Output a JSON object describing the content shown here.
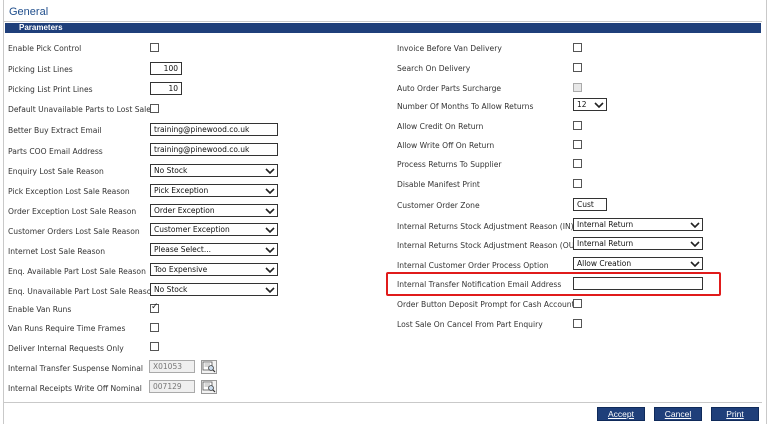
{
  "header": {
    "title": "General",
    "section": "Parameters"
  },
  "left": {
    "enable_pick_control": "Enable Pick Control",
    "picking_list_lines": "Picking List Lines",
    "picking_list_lines_value": "100",
    "picking_list_print_lines": "Picking List Print Lines",
    "picking_list_print_lines_value": "10",
    "default_unavailable": "Default Unavailable Parts to Lost Sale",
    "better_buy_email": "Better Buy Extract Email",
    "better_buy_email_value": "training@pinewood.co.uk",
    "parts_coo_email": "Parts COO Email Address",
    "parts_coo_email_value": "training@pinewood.co.uk",
    "enquiry_lost_sale": "Enquiry Lost Sale Reason",
    "enquiry_lost_sale_value": "No Stock",
    "pick_exception": "Pick Exception Lost Sale Reason",
    "pick_exception_value": "Pick Exception",
    "order_exception": "Order Exception Lost Sale Reason",
    "order_exception_value": "Order Exception",
    "customer_orders": "Customer Orders Lost Sale Reason",
    "customer_orders_value": "Customer Exception",
    "internet_lost_sale": "Internet Lost Sale Reason",
    "internet_lost_sale_value": "Please Select...",
    "enq_available": "Enq. Available Part Lost Sale Reason",
    "enq_available_value": "Too Expensive",
    "enq_unavailable": "Enq. Unavailable Part Lost Sale Reason",
    "enq_unavailable_value": "No Stock",
    "enable_van_runs": "Enable Van Runs",
    "van_runs_time_frames": "Van Runs Require Time Frames",
    "deliver_internal": "Deliver Internal Requests Only",
    "internal_transfer_suspense": "Internal Transfer Suspense Nominal",
    "internal_transfer_suspense_value": "X01053",
    "internal_receipts_write_off": "Internal Receipts Write Off Nominal",
    "internal_receipts_write_off_value": "007129"
  },
  "right": {
    "invoice_before_van": "Invoice Before Van Delivery",
    "search_on_delivery": "Search On Delivery",
    "auto_order_surcharge": "Auto Order Parts Surcharge",
    "months_allow_returns": "Number Of Months To Allow Returns",
    "months_allow_returns_value": "12",
    "allow_credit_return": "Allow Credit On Return",
    "allow_write_off_return": "Allow Write Off On Return",
    "process_returns_supplier": "Process Returns To Supplier",
    "disable_manifest_print": "Disable Manifest Print",
    "customer_order_zone": "Customer Order Zone",
    "customer_order_zone_value": "Cust",
    "returns_adj_in": "Internal Returns Stock Adjustment Reason (IN)",
    "returns_adj_in_value": "Internal Return",
    "returns_adj_out": "Internal Returns Stock Adjustment Reason (OUT)",
    "returns_adj_out_value": "Internal Return",
    "customer_order_process": "Internal Customer Order Process Option",
    "customer_order_process_value": "Allow Creation",
    "transfer_notification_email": "Internal Transfer Notification Email Address",
    "transfer_notification_email_value": "",
    "order_button_deposit": "Order Button Deposit Prompt for Cash Accounts",
    "lost_sale_on_cancel": "Lost Sale On Cancel From Part Enquiry"
  },
  "footer": {
    "accept": "Accept",
    "cancel": "Cancel",
    "print": "Print"
  },
  "colors": {
    "section_bar": "#1f3f7a",
    "title": "#1f4e8c",
    "highlight": "#e01b1b"
  }
}
